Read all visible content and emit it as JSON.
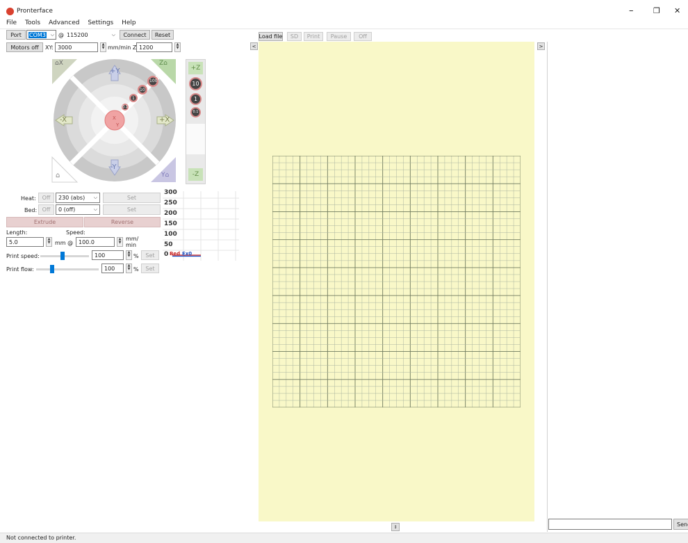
{
  "window": {
    "title": "Pronterface",
    "minimize": "–",
    "maximize": "❐",
    "close": "✕"
  },
  "menu": [
    "File",
    "Tools",
    "Advanced",
    "Settings",
    "Help"
  ],
  "connection": {
    "port_label": "Port",
    "port_value": "COM3",
    "at": "@",
    "baud_value": "115200",
    "connect": "Connect",
    "reset": "Reset"
  },
  "motors": {
    "motors_off": "Motors off",
    "xy_label": "XY:",
    "xy_value": "3000",
    "mm_min_z": "mm/min Z:",
    "z_value": "1200"
  },
  "jog": {
    "home_x": "X",
    "home_z": "Z",
    "home_y": "Y",
    "plus_y": "+Y",
    "minus_y": "-Y",
    "minus_x": "-X",
    "plus_x": "+X",
    "steps": [
      "100",
      "10",
      "1",
      "0.1"
    ],
    "center_x": "X",
    "center_y": "Y",
    "z_plus": "+Z",
    "z_minus": "-Z",
    "z_steps": [
      "10",
      "1",
      "0.1"
    ]
  },
  "temps": {
    "heat_label": "Heat:",
    "heat_off": "Off",
    "heat_value": "230 (abs)",
    "heat_set": "Set",
    "bed_label": "Bed:",
    "bed_off": "Off",
    "bed_value": "0 (off)",
    "bed_set": "Set"
  },
  "extrude": {
    "extrude": "Extrude",
    "reverse": "Reverse",
    "length_label": "Length:",
    "speed_label": "Speed:",
    "length_value": "5.0",
    "mm_at": "mm @",
    "speed_value": "100.0",
    "mm_min_1": "mm/",
    "mm_min_2": "min"
  },
  "print_controls": {
    "speed_label": "Print speed:",
    "speed_value": "100",
    "speed_level": 0.45,
    "flow_label": "Print flow:",
    "flow_value": "100",
    "flow_level": 0.25,
    "pct": "%",
    "set": "Set"
  },
  "temp_graph": {
    "ticks": [
      "300",
      "250",
      "200",
      "150",
      "100",
      "50",
      "0"
    ],
    "legend_bed": "Bed",
    "legend_ex": "Ex0"
  },
  "file_toolbar": {
    "load_file": "Load file",
    "sd": "SD",
    "print": "Print",
    "pause": "Pause",
    "off": "Off"
  },
  "view_toggles": {
    "left": "<",
    "right": ">",
    "bottom": "↕"
  },
  "console": {
    "send": "Send",
    "command_value": ""
  },
  "status_bar": {
    "text": "Not connected to printer."
  },
  "colors": {
    "plate_bg": "#f9f8c8",
    "grid_major": "#6f7a5e",
    "grid_minor": "#aab5a0",
    "app_icon": "#d9412f"
  }
}
